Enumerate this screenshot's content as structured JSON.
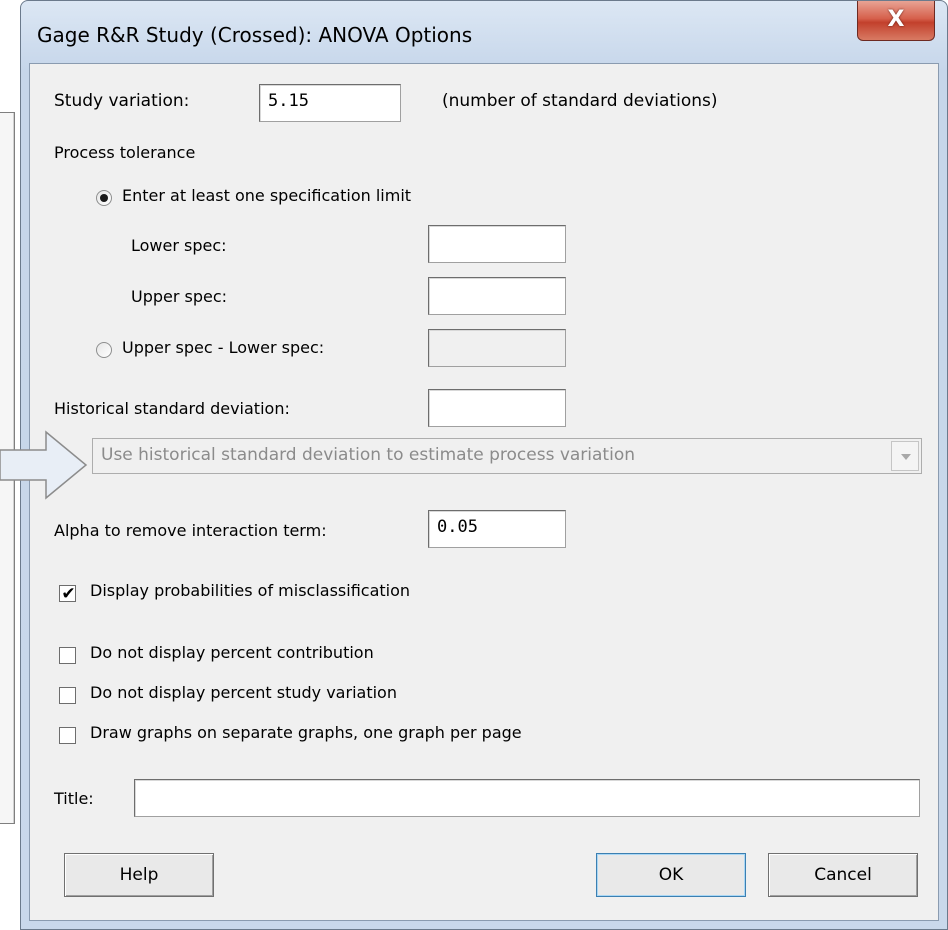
{
  "window": {
    "title": "Gage R&R Study (Crossed): ANOVA Options",
    "close_glyph": "X"
  },
  "study_variation": {
    "label": "Study variation:",
    "value": "5.15",
    "note": "(number of standard deviations)"
  },
  "process_tolerance": {
    "heading": "Process tolerance",
    "option_spec_limit": {
      "label": "Enter at least one specification limit",
      "selected": true
    },
    "lower_spec": {
      "label": "Lower spec:",
      "value": ""
    },
    "upper_spec": {
      "label": "Upper spec:",
      "value": ""
    },
    "option_range": {
      "label": "Upper spec - Lower spec:",
      "selected": false,
      "value": ""
    }
  },
  "historical_sd": {
    "label": "Historical standard deviation:",
    "value": ""
  },
  "historical_use": {
    "selected": "Use historical standard deviation to estimate process variation",
    "enabled": false
  },
  "alpha": {
    "label": "Alpha to remove interaction term:",
    "value": "0.05"
  },
  "checkboxes": {
    "misclassification": {
      "label": "Display probabilities of misclassification",
      "checked": true
    },
    "no_percent_contribution": {
      "label": "Do not display percent contribution",
      "checked": false
    },
    "no_percent_study_variation": {
      "label": "Do not display percent study variation",
      "checked": false
    },
    "separate_graphs": {
      "label": "Draw graphs on separate graphs, one graph per page",
      "checked": false
    }
  },
  "title_field": {
    "label": "Title:",
    "value": ""
  },
  "buttons": {
    "help": "Help",
    "ok": "OK",
    "cancel": "Cancel"
  },
  "colors": {
    "frame": "#c9d8eb",
    "client": "#f0f0f0",
    "close_button": "#c7432f",
    "callout_arrow": "#e8eef6"
  },
  "icons": {
    "close": "close-icon",
    "callout": "arrow-right-icon",
    "dropdown": "chevron-down-icon"
  }
}
